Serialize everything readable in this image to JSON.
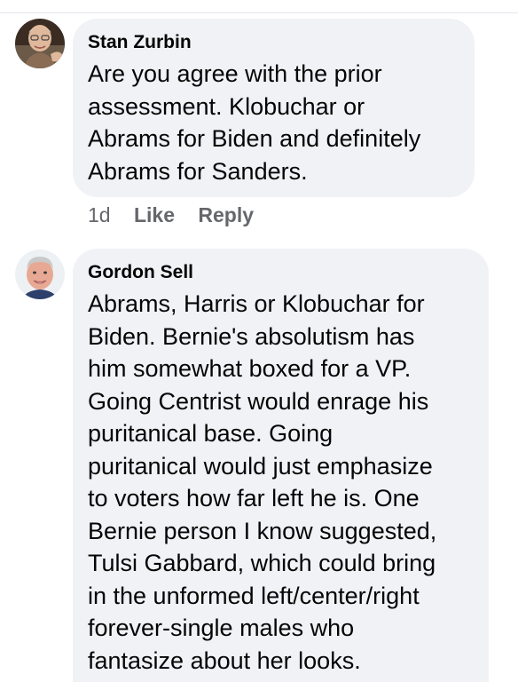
{
  "comments": [
    {
      "author": "Stan Zurbin",
      "avatar_icon": "person-photo-avatar",
      "text_lines": [
        "Are you agree with the prior",
        "assessment. Klobuchar or",
        "Abrams for Biden and definitely",
        "Abrams for Sanders."
      ],
      "timestamp": "1d",
      "like_label": "Like",
      "reply_label": "Reply"
    },
    {
      "author": "Gordon Sell",
      "avatar_icon": "person-photo-avatar",
      "text_lines": [
        "Abrams, Harris or Klobuchar for",
        "Biden.  Bernie's absolutism has",
        "him somewhat boxed for a VP.",
        "Going Centrist would enrage his",
        "puritanical base. Going",
        "puritanical would just emphasize",
        "to voters how far left he is.  One",
        "Bernie person I know suggested,",
        "Tulsi Gabbard, which could bring",
        "in the unformed left/center/right",
        "forever-single males who",
        "fantasize about her looks."
      ]
    }
  ],
  "colors": {
    "bubble_bg": "#f0f2f5",
    "text": "#050505",
    "secondary_text": "#65676b"
  }
}
